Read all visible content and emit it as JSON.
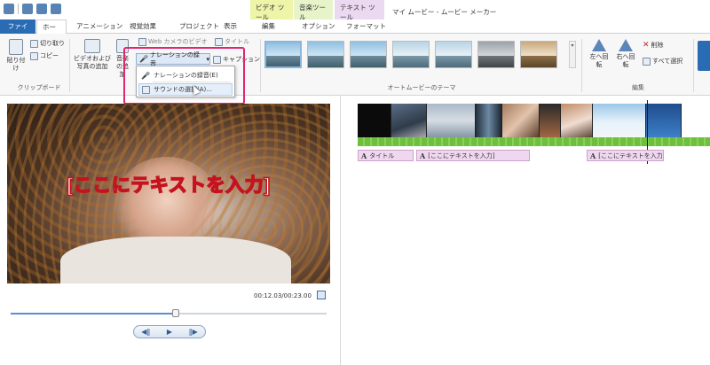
{
  "app": {
    "title": "マイ ムービー - ムービー メーカー"
  },
  "context_groups": {
    "video_tools": "ビデオ ツール",
    "music_tools": "音楽ツール",
    "text_tools": "テキスト ツール"
  },
  "tabs": {
    "file": "ファイル",
    "home": "ホーム",
    "animation": "アニメーション",
    "visual_effects": "視覚効果",
    "project": "プロジェクト",
    "view": "表示",
    "edit": "編集",
    "options": "オプション",
    "format": "フォーマット"
  },
  "ribbon": {
    "clipboard": {
      "paste": "貼り付け",
      "cut": "切り取り",
      "copy": "コピー",
      "group_label": "クリップボード"
    },
    "add": {
      "add_video_photo": "ビデオおよび写真の追加",
      "add_music": "音楽の追加",
      "caption": "キャプション",
      "narration_button": "ナレーションの録音",
      "webcam_fragment": "Web カメラのビデオ",
      "title_fragment": "タイトル"
    },
    "themes": {
      "group_label": "オートムービーのテーマ"
    },
    "editing": {
      "rotate_left": "左へ回転",
      "rotate_right": "右へ回転",
      "delete": "削除",
      "select_all": "すべて選択",
      "group_label": "編集"
    }
  },
  "dropdown": {
    "items": [
      {
        "label": "ナレーションの録音(E)"
      },
      {
        "label": "サウンドの選択(A)..."
      }
    ]
  },
  "preview": {
    "caption_text": "[ここにテキストを入力]",
    "timecode": "00:12.03/00:23.00",
    "progress": 0.523
  },
  "storyboard": {
    "captions": [
      {
        "label": "タイトル"
      },
      {
        "label": "[ここにテキストを入力]"
      },
      {
        "label": "[ここにテキストを入力]"
      }
    ]
  },
  "colors": {
    "file_tab": "#2a6cb4",
    "highlight_box": "#e0266e",
    "caption_stroke": "#c4131f",
    "caption_track": "#f0d7f0"
  }
}
